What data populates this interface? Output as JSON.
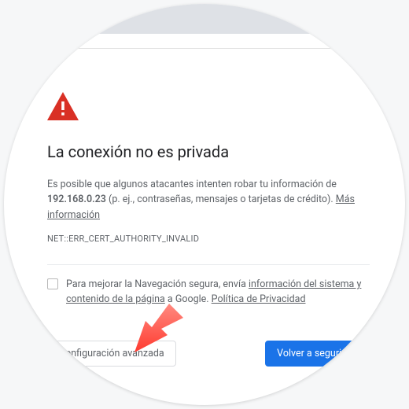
{
  "colors": {
    "danger": "#d93025",
    "primary": "#1a73e8",
    "text_main": "#202124",
    "text_body": "#5f6368"
  },
  "warning": {
    "icon": "warning-triangle",
    "heading": "La conexión no es privada",
    "body_pre": "Es posible que algunos atacantes intenten robar tu información de ",
    "host": "192.168.0.23",
    "body_post": " (p. ej., contraseñas, mensajes o tarjetas de crédito). ",
    "more_info": "Más información",
    "error_code": "NET::ERR_CERT_AUTHORITY_INVALID"
  },
  "optin": {
    "checked": false,
    "text_pre": "Para mejorar la Navegación segura, envía ",
    "link1": "información del sistema y contenido de la página",
    "text_mid": " a Google. ",
    "link2": "Política de Privacidad"
  },
  "buttons": {
    "advanced": "Configuración avanzada",
    "back_to_safety": "Volver a seguridad"
  },
  "overlay": {
    "arrow": "red-arrow-pointing-bottom-left"
  }
}
